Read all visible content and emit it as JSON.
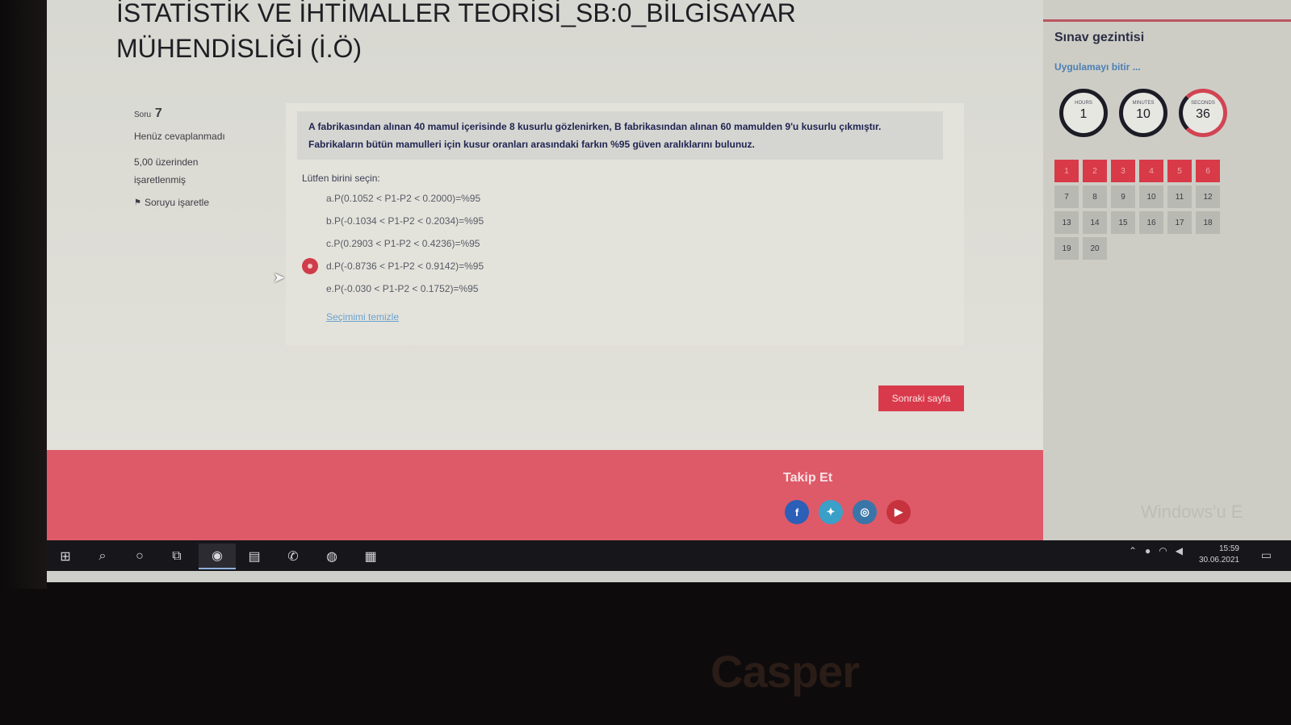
{
  "course": {
    "title_line1": "İSTATİSTİK VE İHTİMALLER TEORİSİ_SB:0_BİLGİSAYAR",
    "title_line2": "MÜHENDİSLİĞİ (İ.Ö)"
  },
  "question_info": {
    "label": "Soru",
    "number": "7",
    "status": "Henüz cevaplanmadı",
    "grade_line1": "5,00 üzerinden",
    "grade_line2": "işaretlenmiş",
    "flag_label": "Soruyu işaretle"
  },
  "question": {
    "text_line1": "A fabrikasından alınan 40 mamul içerisinde 8 kusurlu gözlenirken, B fabrikasından alınan 60 mamulden 9'u kusurlu çıkmıştır.",
    "text_line2": "Fabrikaların bütün mamulleri için kusur oranları arasındaki farkın %95 güven aralıklarını bulunuz.",
    "select_label": "Lütfen birini seçin:",
    "options": [
      {
        "label": "a.P(0.1052 < P1-P2 < 0.2000)=%95",
        "selected": false
      },
      {
        "label": "b.P(-0.1034 < P1-P2 < 0.2034)=%95",
        "selected": false
      },
      {
        "label": "c.P(0.2903 < P1-P2 < 0.4236)=%95",
        "selected": false
      },
      {
        "label": "d.P(-0.8736 < P1-P2 < 0.9142)=%95",
        "selected": true
      },
      {
        "label": "e.P(-0.030 < P1-P2 < 0.1752)=%95",
        "selected": false
      }
    ],
    "clear_label": "Seçimimi temizle"
  },
  "next_button": "Sonraki sayfa",
  "footer": {
    "follow_label": "Takip Et",
    "socials": [
      {
        "icon": "facebook-icon",
        "glyph": "f",
        "color": "#2b5fb8"
      },
      {
        "icon": "twitter-icon",
        "glyph": "✦",
        "color": "#3aa0c8"
      },
      {
        "icon": "instagram-icon",
        "glyph": "◎",
        "color": "#3a75a8"
      },
      {
        "icon": "youtube-icon",
        "glyph": "▶",
        "color": "#c6323d"
      }
    ]
  },
  "sidebar": {
    "title": "Sınav gezintisi",
    "finish_link": "Uygulamayı bitir ...",
    "timer": {
      "hours_label": "HOURS",
      "hours": "1",
      "minutes_label": "MINUTES",
      "minutes": "10",
      "seconds_label": "SECONDS",
      "seconds": "36"
    },
    "questions": [
      "1",
      "2",
      "3",
      "4",
      "5",
      "6",
      "7",
      "8",
      "9",
      "10",
      "11",
      "12",
      "13",
      "14",
      "15",
      "16",
      "17",
      "18",
      "19",
      "20"
    ],
    "answered_count": 6
  },
  "watermark": "Windows'u E",
  "taskbar": {
    "time": "15:59",
    "date": "30.06.2021"
  },
  "device_logo": "Casper"
}
